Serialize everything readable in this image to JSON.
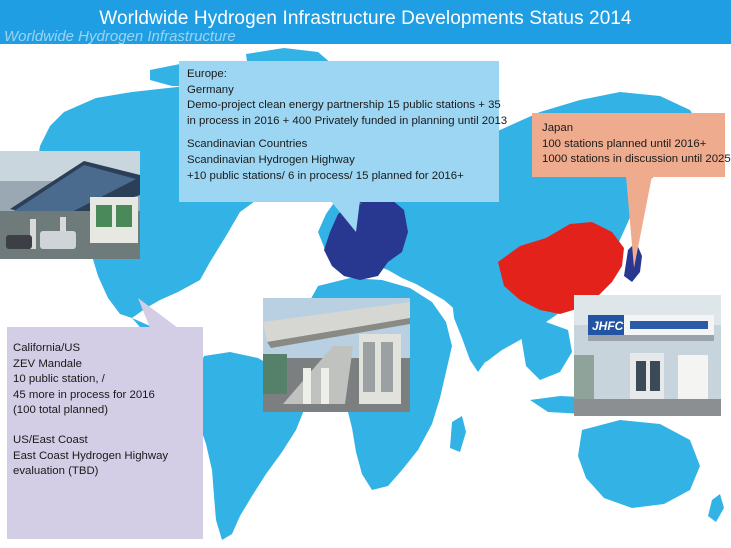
{
  "title": "Worldwide Hydrogen Infrastructure Developments Status 2014",
  "title_ghost": [
    "Worldwide Hydrogen Infrastructure",
    "Developments Status 2014"
  ],
  "colors": {
    "title_bar": "#1f9ee3",
    "land": "#33b2e6",
    "europe_highlight": "#28378f",
    "china_highlight": "#e3231b",
    "europe_box": "#9dd6f3",
    "japan_box": "#eeab8d",
    "us_box": "#d4cde6"
  },
  "callouts": {
    "europe": {
      "lines": [
        "Europe:",
        "Germany",
        "Demo-project clean energy partnership 15 public stations + 35",
        "in process in 2016 + 400 Privately funded in planning until 2013",
        "Scandinavian Countries",
        "Scandinavian Hydrogen Highway",
        "+10 public stations/ 6 in process/ 15 planned for 2016+"
      ]
    },
    "japan": {
      "lines": [
        "Japan",
        "100 stations planned until 2016+",
        "1000 stations in discussion until 2025"
      ]
    },
    "us": {
      "lines": [
        "California/US",
        "ZEV Mandale",
        "10 public station, /",
        "45 more in process for 2016",
        "(100 total planned)",
        "US/East Coast",
        "East Coast Hydrogen Highway",
        "evaluation (TBD)"
      ]
    }
  },
  "photos": {
    "japan_sign": "JHFC"
  }
}
